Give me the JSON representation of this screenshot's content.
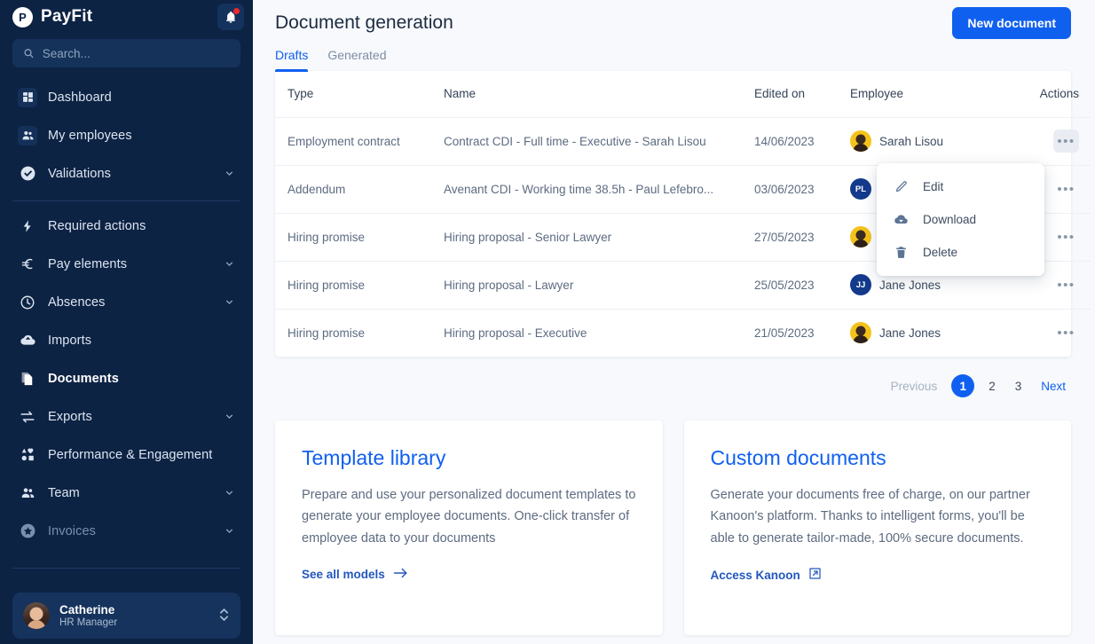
{
  "sidebar": {
    "brand": {
      "logo_letter": "P",
      "name": "PayFit"
    },
    "notifications_icon": "bell-icon",
    "search": {
      "placeholder": "Search...",
      "value": ""
    },
    "items": [
      {
        "label": "Dashboard",
        "icon": "dashboard-icon",
        "chevron": false,
        "active": false,
        "dim": false,
        "boxed": true
      },
      {
        "label": "My employees",
        "icon": "people-icon",
        "chevron": false,
        "active": false,
        "dim": false,
        "boxed": true
      },
      {
        "label": "Validations",
        "icon": "check-circle-icon",
        "chevron": true,
        "active": false,
        "dim": false,
        "boxed": false
      }
    ],
    "items2": [
      {
        "label": "Required actions",
        "icon": "bolt-icon",
        "chevron": false,
        "active": false,
        "dim": false
      },
      {
        "label": "Pay elements",
        "icon": "euro-icon",
        "chevron": true,
        "active": false,
        "dim": false
      },
      {
        "label": "Absences",
        "icon": "clock-icon",
        "chevron": true,
        "active": false,
        "dim": false
      },
      {
        "label": "Imports",
        "icon": "cloud-upload-icon",
        "chevron": false,
        "active": false,
        "dim": false
      },
      {
        "label": "Documents",
        "icon": "documents-icon",
        "chevron": false,
        "active": true,
        "dim": false
      },
      {
        "label": "Exports",
        "icon": "exchange-icon",
        "chevron": true,
        "active": false,
        "dim": false
      },
      {
        "label": "Performance & Engagement",
        "icon": "shapes-icon",
        "chevron": false,
        "active": false,
        "dim": false
      },
      {
        "label": "Team",
        "icon": "team-icon",
        "chevron": true,
        "active": false,
        "dim": false
      },
      {
        "label": "Invoices",
        "icon": "star-circle-icon",
        "chevron": true,
        "active": false,
        "dim": true
      }
    ],
    "user": {
      "name": "Catherine",
      "role": "HR Manager",
      "avatar": "user-avatar"
    }
  },
  "header": {
    "title": "Document generation",
    "new_document_label": "New document"
  },
  "tabs": [
    {
      "label": "Drafts",
      "active": true
    },
    {
      "label": "Generated",
      "active": false
    }
  ],
  "table": {
    "columns": [
      "Type",
      "Name",
      "Edited on",
      "Employee",
      "Actions"
    ],
    "rows": [
      {
        "type": "Employment contract",
        "name": "Contract CDI - Full time - Executive - Sarah Lisou",
        "edited_on": "14/06/2023",
        "employee": "Sarah Lisou",
        "avatar_kind": "photo",
        "avatar_initials": "",
        "actions_icon": "more-horizontal-icon",
        "menu_open": true
      },
      {
        "type": "Addendum",
        "name": "Avenant CDI - Working time 38.5h - Paul Lefebro...",
        "edited_on": "03/06/2023",
        "employee": "",
        "avatar_kind": "initials",
        "avatar_initials": "PL",
        "actions_icon": "more-horizontal-icon",
        "menu_open": false
      },
      {
        "type": "Hiring promise",
        "name": "Hiring proposal - Senior Lawyer",
        "edited_on": "27/05/2023",
        "employee": "",
        "avatar_kind": "photo",
        "avatar_initials": "",
        "actions_icon": "more-horizontal-icon",
        "menu_open": false
      },
      {
        "type": "Hiring promise",
        "name": "Hiring proposal - Lawyer",
        "edited_on": "25/05/2023",
        "employee": "Jane Jones",
        "avatar_kind": "initials",
        "avatar_initials": "JJ",
        "actions_icon": "more-horizontal-icon",
        "menu_open": false
      },
      {
        "type": "Hiring promise",
        "name": "Hiring proposal - Executive",
        "edited_on": "21/05/2023",
        "employee": "Jane Jones",
        "avatar_kind": "photo",
        "avatar_initials": "",
        "actions_icon": "more-horizontal-icon",
        "menu_open": false
      }
    ]
  },
  "row_menu": {
    "items": [
      {
        "label": "Edit",
        "icon": "pencil-icon"
      },
      {
        "label": "Download",
        "icon": "cloud-download-icon"
      },
      {
        "label": "Delete",
        "icon": "trash-icon"
      }
    ]
  },
  "pagination": {
    "previous_label": "Previous",
    "pages": [
      "1",
      "2",
      "3"
    ],
    "current": "1",
    "next_label": "Next"
  },
  "info_cards": [
    {
      "title": "Template library",
      "body": "Prepare and use your personalized document templates to generate your employee documents. One-click transfer of employee data to your documents",
      "link_label": "See all models",
      "link_icon": "arrow-right-icon"
    },
    {
      "title": "Custom documents",
      "body": "Generate your documents free of charge, on our partner Kanoon's platform. Thanks to intelligent forms, you'll be able to generate tailor-made, 100% secure documents.",
      "link_label": "Access Kanoon",
      "link_icon": "external-link-icon"
    }
  ],
  "colors": {
    "sidebar_bg": "#0d2344",
    "accent": "#1060f0",
    "page_bg": "#f7f9fc",
    "notification_dot": "#f0282d",
    "avatar_yellow": "#f5c21b",
    "avatar_blue": "#133a8c"
  }
}
